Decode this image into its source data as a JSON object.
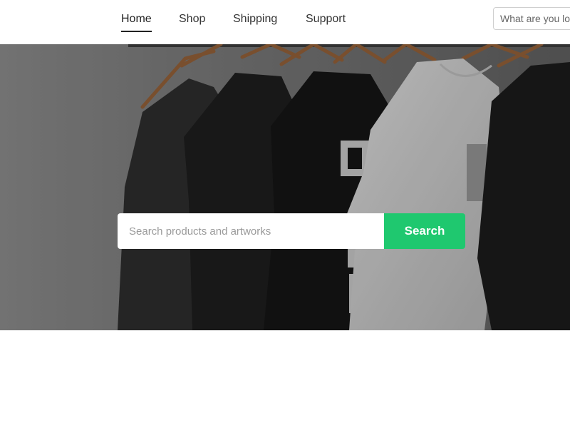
{
  "nav": {
    "items": [
      {
        "label": "Home",
        "active": true
      },
      {
        "label": "Shop",
        "active": false
      },
      {
        "label": "Shipping",
        "active": false
      },
      {
        "label": "Support",
        "active": false
      }
    ]
  },
  "header_search": {
    "placeholder": "What are you looking for?"
  },
  "hero": {
    "image": "black-and-white-t-shirts-on-hangers",
    "search": {
      "placeholder": "Search products and artworks",
      "button_label": "Search"
    }
  },
  "colors": {
    "accent": "#1fc86f",
    "nav_active_underline": "#222222"
  }
}
